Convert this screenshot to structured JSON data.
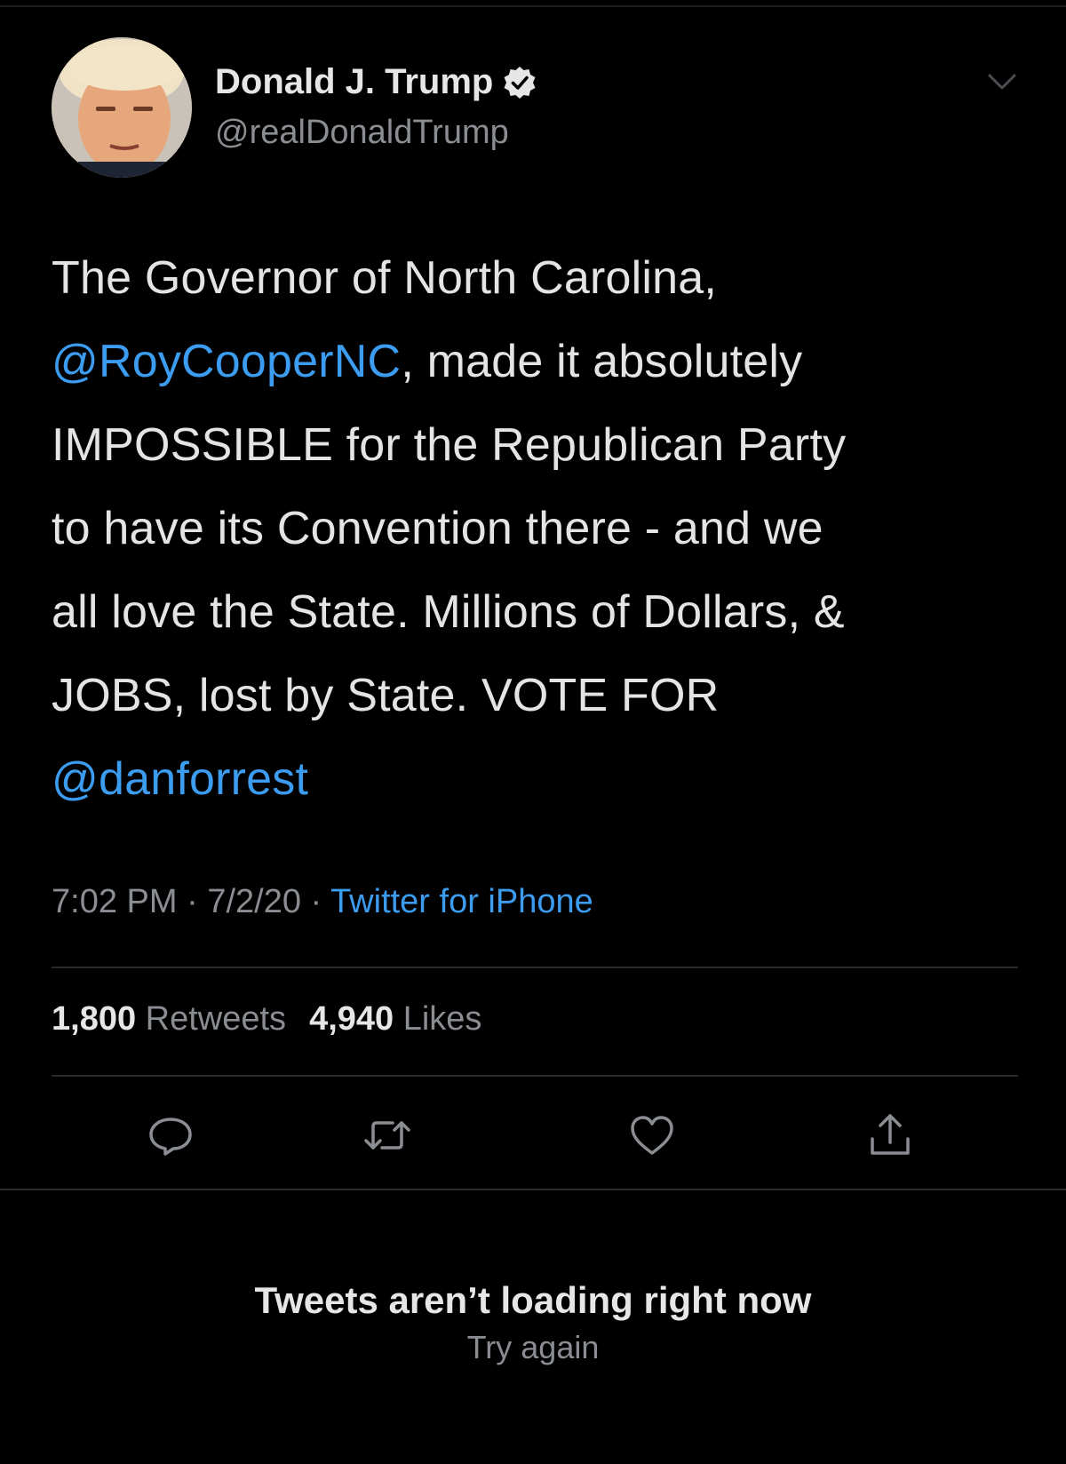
{
  "author": {
    "name": "Donald J. Trump",
    "handle": "@realDonaldTrump",
    "verified": true,
    "avatar_icon": "profile-photo"
  },
  "tweet": {
    "lines": [
      [
        {
          "text": "The Governor of North Carolina,",
          "mention": false
        }
      ],
      [
        {
          "text": "@RoyCooperNC",
          "mention": true
        },
        {
          "text": ", made it absolutely",
          "mention": false
        }
      ],
      [
        {
          "text": "IMPOSSIBLE for the Republican Party",
          "mention": false
        }
      ],
      [
        {
          "text": "to have its Convention there - and we",
          "mention": false
        }
      ],
      [
        {
          "text": "all love the State. Millions of Dollars, &",
          "mention": false
        }
      ],
      [
        {
          "text": "JOBS, lost by State. VOTE FOR",
          "mention": false
        }
      ],
      [
        {
          "text": "@danforrest",
          "mention": true
        }
      ]
    ],
    "time": "7:02 PM",
    "date": "7/2/20",
    "separator": " · ",
    "source": "Twitter for iPhone"
  },
  "stats": {
    "retweets_count": "1,800",
    "retweets_label": "Retweets",
    "likes_count": "4,940",
    "likes_label": "Likes"
  },
  "actions": [
    "reply-icon",
    "retweet-icon",
    "like-icon",
    "share-icon"
  ],
  "footer": {
    "title": "Tweets aren’t loading right now",
    "retry": "Try again"
  },
  "colors": {
    "background": "#000000",
    "link": "#3b9cf0",
    "secondary_text": "#8a8d91",
    "primary_text": "#e4e4e4"
  }
}
